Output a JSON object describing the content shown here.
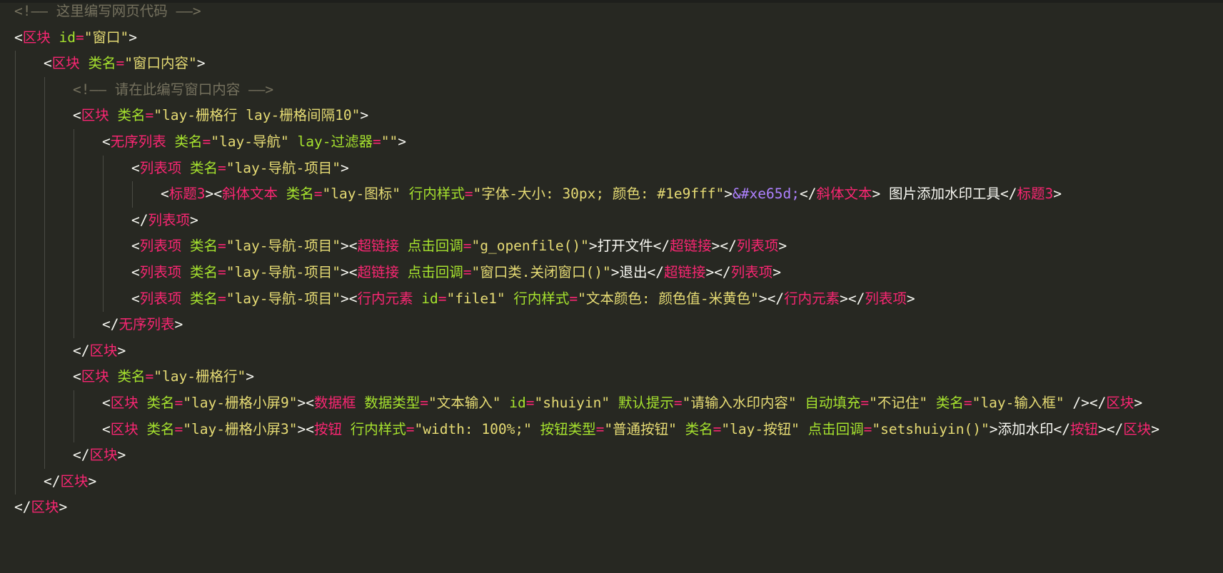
{
  "editor": {
    "lines": [
      {
        "indent": 0,
        "tokens": [
          [
            "t-comment",
            "<!—— 这里编写网页代码 ——>"
          ]
        ]
      },
      {
        "indent": 0,
        "tokens": [
          [
            "t-punct",
            "<"
          ],
          [
            "t-tag",
            "区块"
          ],
          [
            "t-text",
            " "
          ],
          [
            "t-attr",
            "id"
          ],
          [
            "t-eq",
            "="
          ],
          [
            "t-str",
            "\"窗口\""
          ],
          [
            "t-punct",
            ">"
          ]
        ]
      },
      {
        "indent": 1,
        "tokens": [
          [
            "t-punct",
            "<"
          ],
          [
            "t-tag",
            "区块"
          ],
          [
            "t-text",
            " "
          ],
          [
            "t-attr",
            "类名"
          ],
          [
            "t-eq",
            "="
          ],
          [
            "t-str",
            "\"窗口内容\""
          ],
          [
            "t-punct",
            ">"
          ]
        ]
      },
      {
        "indent": 2,
        "tokens": [
          [
            "t-comment",
            "<!—— 请在此编写窗口内容 ——>"
          ]
        ]
      },
      {
        "indent": 2,
        "tokens": [
          [
            "t-punct",
            "<"
          ],
          [
            "t-tag",
            "区块"
          ],
          [
            "t-text",
            " "
          ],
          [
            "t-attr",
            "类名"
          ],
          [
            "t-eq",
            "="
          ],
          [
            "t-str",
            "\"lay-栅格行 lay-栅格间隔10\""
          ],
          [
            "t-punct",
            ">"
          ]
        ]
      },
      {
        "indent": 3,
        "tokens": [
          [
            "t-punct",
            "<"
          ],
          [
            "t-tag",
            "无序列表"
          ],
          [
            "t-text",
            " "
          ],
          [
            "t-attr",
            "类名"
          ],
          [
            "t-eq",
            "="
          ],
          [
            "t-str",
            "\"lay-导航\""
          ],
          [
            "t-text",
            " "
          ],
          [
            "t-attr",
            "lay-过滤器"
          ],
          [
            "t-eq",
            "="
          ],
          [
            "t-str",
            "\"\""
          ],
          [
            "t-punct",
            ">"
          ]
        ]
      },
      {
        "indent": 4,
        "tokens": [
          [
            "t-punct",
            "<"
          ],
          [
            "t-tag",
            "列表项"
          ],
          [
            "t-text",
            " "
          ],
          [
            "t-attr",
            "类名"
          ],
          [
            "t-eq",
            "="
          ],
          [
            "t-str",
            "\"lay-导航-项目\""
          ],
          [
            "t-punct",
            ">"
          ]
        ]
      },
      {
        "indent": 5,
        "tokens": [
          [
            "t-punct",
            "<"
          ],
          [
            "t-tag",
            "标题3"
          ],
          [
            "t-punct",
            "><"
          ],
          [
            "t-tag",
            "斜体文本"
          ],
          [
            "t-text",
            " "
          ],
          [
            "t-attr",
            "类名"
          ],
          [
            "t-eq",
            "="
          ],
          [
            "t-str",
            "\"lay-图标\""
          ],
          [
            "t-text",
            " "
          ],
          [
            "t-attr",
            "行内样式"
          ],
          [
            "t-eq",
            "="
          ],
          [
            "t-str",
            "\"字体-大小: 30px; 颜色: #1e9fff\""
          ],
          [
            "t-punct",
            ">"
          ],
          [
            "t-entity",
            "&#xe65d;"
          ],
          [
            "t-punct",
            "</"
          ],
          [
            "t-tag",
            "斜体文本"
          ],
          [
            "t-punct",
            ">"
          ],
          [
            "t-text",
            " 图片添加水印工具"
          ],
          [
            "t-punct",
            "</"
          ],
          [
            "t-tag",
            "标题3"
          ],
          [
            "t-punct",
            ">"
          ]
        ]
      },
      {
        "indent": 4,
        "tokens": [
          [
            "t-punct",
            "</"
          ],
          [
            "t-tag",
            "列表项"
          ],
          [
            "t-punct",
            ">"
          ]
        ]
      },
      {
        "indent": 4,
        "tokens": [
          [
            "t-punct",
            "<"
          ],
          [
            "t-tag",
            "列表项"
          ],
          [
            "t-text",
            " "
          ],
          [
            "t-attr",
            "类名"
          ],
          [
            "t-eq",
            "="
          ],
          [
            "t-str",
            "\"lay-导航-项目\""
          ],
          [
            "t-punct",
            "><"
          ],
          [
            "t-tag",
            "超链接"
          ],
          [
            "t-text",
            " "
          ],
          [
            "t-attr",
            "点击回调"
          ],
          [
            "t-eq",
            "="
          ],
          [
            "t-str",
            "\"g_openfile()\""
          ],
          [
            "t-punct",
            ">"
          ],
          [
            "t-text",
            "打开文件"
          ],
          [
            "t-punct",
            "</"
          ],
          [
            "t-tag",
            "超链接"
          ],
          [
            "t-punct",
            "></"
          ],
          [
            "t-tag",
            "列表项"
          ],
          [
            "t-punct",
            ">"
          ]
        ]
      },
      {
        "indent": 4,
        "tokens": [
          [
            "t-punct",
            "<"
          ],
          [
            "t-tag",
            "列表项"
          ],
          [
            "t-text",
            " "
          ],
          [
            "t-attr",
            "类名"
          ],
          [
            "t-eq",
            "="
          ],
          [
            "t-str",
            "\"lay-导航-项目\""
          ],
          [
            "t-punct",
            "><"
          ],
          [
            "t-tag",
            "超链接"
          ],
          [
            "t-text",
            " "
          ],
          [
            "t-attr",
            "点击回调"
          ],
          [
            "t-eq",
            "="
          ],
          [
            "t-str",
            "\"窗口类.关闭窗口()\""
          ],
          [
            "t-punct",
            ">"
          ],
          [
            "t-text",
            "退出"
          ],
          [
            "t-punct",
            "</"
          ],
          [
            "t-tag",
            "超链接"
          ],
          [
            "t-punct",
            "></"
          ],
          [
            "t-tag",
            "列表项"
          ],
          [
            "t-punct",
            ">"
          ]
        ]
      },
      {
        "indent": 4,
        "tokens": [
          [
            "t-punct",
            "<"
          ],
          [
            "t-tag",
            "列表项"
          ],
          [
            "t-text",
            " "
          ],
          [
            "t-attr",
            "类名"
          ],
          [
            "t-eq",
            "="
          ],
          [
            "t-str",
            "\"lay-导航-项目\""
          ],
          [
            "t-punct",
            "><"
          ],
          [
            "t-tag",
            "行内元素"
          ],
          [
            "t-text",
            " "
          ],
          [
            "t-attr",
            "id"
          ],
          [
            "t-eq",
            "="
          ],
          [
            "t-str",
            "\"file1\""
          ],
          [
            "t-text",
            " "
          ],
          [
            "t-attr",
            "行内样式"
          ],
          [
            "t-eq",
            "="
          ],
          [
            "t-str",
            "\"文本颜色: 颜色值-米黄色\""
          ],
          [
            "t-punct",
            "></"
          ],
          [
            "t-tag",
            "行内元素"
          ],
          [
            "t-punct",
            "></"
          ],
          [
            "t-tag",
            "列表项"
          ],
          [
            "t-punct",
            ">"
          ]
        ]
      },
      {
        "indent": 3,
        "tokens": [
          [
            "t-punct",
            "</"
          ],
          [
            "t-tag",
            "无序列表"
          ],
          [
            "t-punct",
            ">"
          ]
        ]
      },
      {
        "indent": 2,
        "tokens": [
          [
            "t-punct",
            "</"
          ],
          [
            "t-tag",
            "区块"
          ],
          [
            "t-punct",
            ">"
          ]
        ]
      },
      {
        "indent": 2,
        "tokens": [
          [
            "t-punct",
            "<"
          ],
          [
            "t-tag",
            "区块"
          ],
          [
            "t-text",
            " "
          ],
          [
            "t-attr",
            "类名"
          ],
          [
            "t-eq",
            "="
          ],
          [
            "t-str",
            "\"lay-栅格行\""
          ],
          [
            "t-punct",
            ">"
          ]
        ]
      },
      {
        "indent": 3,
        "tokens": [
          [
            "t-punct",
            "<"
          ],
          [
            "t-tag",
            "区块"
          ],
          [
            "t-text",
            " "
          ],
          [
            "t-attr",
            "类名"
          ],
          [
            "t-eq",
            "="
          ],
          [
            "t-str",
            "\"lay-栅格小屏9\""
          ],
          [
            "t-punct",
            "><"
          ],
          [
            "t-tag",
            "数据框"
          ],
          [
            "t-text",
            " "
          ],
          [
            "t-attr",
            "数据类型"
          ],
          [
            "t-eq",
            "="
          ],
          [
            "t-str",
            "\"文本输入\""
          ],
          [
            "t-text",
            " "
          ],
          [
            "t-attr",
            "id"
          ],
          [
            "t-eq",
            "="
          ],
          [
            "t-str",
            "\"shuiyin\""
          ],
          [
            "t-text",
            " "
          ],
          [
            "t-attr",
            "默认提示"
          ],
          [
            "t-eq",
            "="
          ],
          [
            "t-str",
            "\"请输入水印内容\""
          ],
          [
            "t-text",
            " "
          ],
          [
            "t-attr",
            "自动填充"
          ],
          [
            "t-eq",
            "="
          ],
          [
            "t-str",
            "\"不记住\""
          ],
          [
            "t-text",
            " "
          ],
          [
            "t-attr",
            "类名"
          ],
          [
            "t-eq",
            "="
          ],
          [
            "t-str",
            "\"lay-输入框\""
          ],
          [
            "t-text",
            " "
          ],
          [
            "t-punct",
            "/></"
          ],
          [
            "t-tag",
            "区块"
          ],
          [
            "t-punct",
            ">"
          ]
        ]
      },
      {
        "indent": 3,
        "tokens": [
          [
            "t-punct",
            "<"
          ],
          [
            "t-tag",
            "区块"
          ],
          [
            "t-text",
            " "
          ],
          [
            "t-attr",
            "类名"
          ],
          [
            "t-eq",
            "="
          ],
          [
            "t-str",
            "\"lay-栅格小屏3\""
          ],
          [
            "t-punct",
            "><"
          ],
          [
            "t-tag",
            "按钮"
          ],
          [
            "t-text",
            " "
          ],
          [
            "t-attr",
            "行内样式"
          ],
          [
            "t-eq",
            "="
          ],
          [
            "t-str",
            "\"width: 100%;\""
          ],
          [
            "t-text",
            " "
          ],
          [
            "t-attr",
            "按钮类型"
          ],
          [
            "t-eq",
            "="
          ],
          [
            "t-str",
            "\"普通按钮\""
          ],
          [
            "t-text",
            " "
          ],
          [
            "t-attr",
            "类名"
          ],
          [
            "t-eq",
            "="
          ],
          [
            "t-str",
            "\"lay-按钮\""
          ],
          [
            "t-text",
            " "
          ],
          [
            "t-attr",
            "点击回调"
          ],
          [
            "t-eq",
            "="
          ],
          [
            "t-str",
            "\"setshuiyin()\""
          ],
          [
            "t-punct",
            ">"
          ],
          [
            "t-text",
            "添加水印"
          ],
          [
            "t-punct",
            "</"
          ],
          [
            "t-tag",
            "按钮"
          ],
          [
            "t-punct",
            "></"
          ],
          [
            "t-tag",
            "区块"
          ],
          [
            "t-punct",
            ">"
          ]
        ]
      },
      {
        "indent": 2,
        "tokens": [
          [
            "t-punct",
            "</"
          ],
          [
            "t-tag",
            "区块"
          ],
          [
            "t-punct",
            ">"
          ]
        ]
      },
      {
        "indent": 1,
        "tokens": [
          [
            "t-punct",
            "</"
          ],
          [
            "t-tag",
            "区块"
          ],
          [
            "t-punct",
            ">"
          ]
        ]
      },
      {
        "indent": 0,
        "tokens": [
          [
            "t-punct",
            "</"
          ],
          [
            "t-tag",
            "区块"
          ],
          [
            "t-punct",
            ">"
          ]
        ]
      }
    ]
  }
}
